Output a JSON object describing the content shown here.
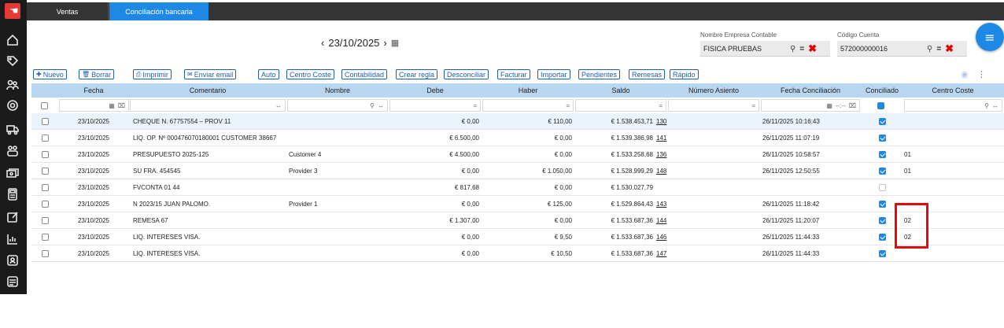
{
  "tabs": [
    {
      "label": "Ventas"
    },
    {
      "label": "Conciliación bancaria"
    }
  ],
  "date_nav": {
    "date": "23/10/2025",
    "prev": "‹",
    "next": "›"
  },
  "empresa": {
    "label": "Nombre Empresa Contable",
    "value": "FISICA PRUEBAS"
  },
  "cuenta": {
    "label": "Código Cuenta",
    "value": "572000000016"
  },
  "toolbar": {
    "nuevo": "Nuevo",
    "borrar": "Borrar",
    "imprimir": "Imprimir",
    "enviar_email": "Enviar email",
    "auto": "Auto",
    "centro_coste": "Centro Coste",
    "contabilidad": "Contabilidad",
    "crear_regla": "Crear regla",
    "desconciliar": "Desconciliar",
    "facturar": "Facturar",
    "importar": "Importar",
    "pendientes": "Pendientes",
    "remesas": "Remesas",
    "rapido": "Rápido"
  },
  "columns": {
    "fecha": "Fecha",
    "comentario": "Comentario",
    "nombre": "Nombre",
    "debe": "Debe",
    "haber": "Haber",
    "saldo": "Saldo",
    "numero_asiento": "Número Asiento",
    "fecha_conciliacion": "Fecha Conciliación",
    "conciliado": "Conciliado",
    "centro_coste": "Centro Coste"
  },
  "filters": {
    "time_placeholder": "--:--",
    "eq": "="
  },
  "rows": [
    {
      "fecha": "23/10/2025",
      "comentario": "CHEQUE N. 67757554 – PROV 11",
      "nombre": "",
      "debe": "€ 0,00",
      "haber": "€ 110,00",
      "saldo": "€ 1.538.453,71",
      "asiento": "130",
      "fecha_conc": "26/11/2025 10:16:43",
      "conciliado": "on",
      "centro": ""
    },
    {
      "fecha": "23/10/2025",
      "comentario": "LIQ. OP. Nº 000476070180001 CUSTOMER 38667",
      "nombre": "",
      "debe": "€ 6.500,00",
      "haber": "€ 0,00",
      "saldo": "€ 1.539.386,98",
      "asiento": "141",
      "fecha_conc": "26/11/2025 11:07:19",
      "conciliado": "on",
      "centro": ""
    },
    {
      "fecha": "23/10/2025",
      "comentario": "PRESUPUESTO 2025-125",
      "nombre": "Customer 4",
      "debe": "€ 4.500,00",
      "haber": "€ 0,00",
      "saldo": "€ 1.533.258,68",
      "asiento": "136",
      "fecha_conc": "26/11/2025 10:58:57",
      "conciliado": "on",
      "centro": "01"
    },
    {
      "fecha": "23/10/2025",
      "comentario": "SU FRA. 454545",
      "nombre": "Provider 3",
      "debe": "€ 0,00",
      "haber": "€ 1.050,00",
      "saldo": "€ 1.528.999,29",
      "asiento": "148",
      "fecha_conc": "26/11/2025 12:50:55",
      "conciliado": "on",
      "centro": "01"
    },
    {
      "fecha": "23/10/2025",
      "comentario": "FVCONTA 01 44",
      "nombre": "",
      "debe": "€ 817,68",
      "haber": "€ 0,00",
      "saldo": "€ 1.530.027,79",
      "asiento": "",
      "fecha_conc": "",
      "conciliado": "off",
      "centro": ""
    },
    {
      "fecha": "23/10/2025",
      "comentario": "N 2023/15 JUAN PALOMO.",
      "nombre": "Provider 1",
      "debe": "€ 0,00",
      "haber": "€ 125,00",
      "saldo": "€ 1.529.864,43",
      "asiento": "143",
      "fecha_conc": "26/11/2025 11:18:42",
      "conciliado": "on",
      "centro": ""
    },
    {
      "fecha": "23/10/2025",
      "comentario": "REMESA 67",
      "nombre": "",
      "debe": "€ 1.307,00",
      "haber": "€ 0,00",
      "saldo": "€ 1.533.687,36",
      "asiento": "144",
      "fecha_conc": "26/11/2025 11:20:07",
      "conciliado": "on",
      "centro": "02"
    },
    {
      "fecha": "23/10/2025",
      "comentario": "LIQ. INTERESES VISA.",
      "nombre": "",
      "debe": "€ 0,00",
      "haber": "€ 9,50",
      "saldo": "€ 1.533.687,36",
      "asiento": "146",
      "fecha_conc": "26/11/2025 11:44:33",
      "conciliado": "on",
      "centro": "02"
    },
    {
      "fecha": "23/10/2025",
      "comentario": "LIQ. INTERESES VISA.",
      "nombre": "",
      "debe": "€ 0,00",
      "haber": "€ 10,50",
      "saldo": "€ 1.533.687,36",
      "asiento": "147",
      "fecha_conc": "26/11/2025 11:44:33",
      "conciliado": "on",
      "centro": ""
    }
  ],
  "colors": {
    "accent": "#1e88e5",
    "header_bg": "#b9d6f0",
    "highlight": "#e10d0d",
    "sidebar": "#1b1b1b"
  },
  "icons": [
    "logo-icon",
    "home-icon",
    "tag-icon",
    "users-icon",
    "target-icon",
    "truck-icon",
    "team-icon",
    "money-icon",
    "calculator-icon",
    "edit-icon",
    "chart-icon",
    "id-card-icon",
    "list-icon",
    "search-icon",
    "close-icon",
    "calendar-icon",
    "menu-icon",
    "eye-icon",
    "more-icon"
  ]
}
